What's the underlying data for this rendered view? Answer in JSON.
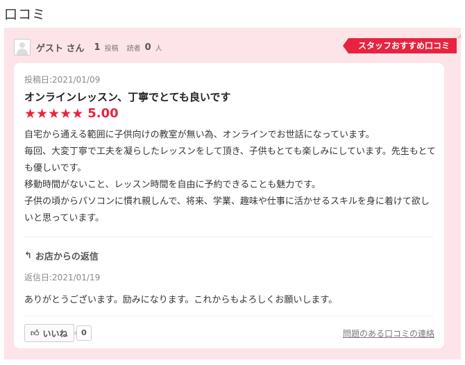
{
  "page": {
    "title": "口コミ"
  },
  "user": {
    "name": "ゲスト さん",
    "posts_count": "1",
    "posts_label": "投稿",
    "readers_label": "読者",
    "readers_count": "0",
    "readers_unit": "人"
  },
  "badge": {
    "label": "スタッフおすすめ口コミ"
  },
  "review": {
    "date": "投稿日:2021/01/09",
    "title": "オンラインレッスン、丁寧でとても良いです",
    "rating": "5.00",
    "rating_stars": 5,
    "body": [
      "自宅から通える範囲に子供向けの教室が無い為、オンラインでお世話になっています。",
      "毎回、大変丁寧で工夫を凝らしたレッスンをして頂き、子供もとても楽しみにしています。先生もとても優しいです。",
      "移動時間がないこと、レッスン時間を自由に予約できることも魅力です。",
      "子供の頃からパソコンに慣れ親しんで、将来、学業、趣味や仕事に活かせるスキルを身に着けて欲しいと思っています。"
    ]
  },
  "reply": {
    "heading": "お店からの返信",
    "date": "返信日:2021/01/19",
    "body": "ありがとうございます。励みになります。これからもよろしくお願いします。"
  },
  "actions": {
    "like_label": "いいね",
    "like_count": "0",
    "report_label": "問題のある口コミの連絡"
  },
  "colors": {
    "accent": "#e8233f",
    "card_bg": "#fde4e8"
  },
  "icons": {
    "reply": "reply-arrow-icon",
    "like": "thumbs-up-icon"
  }
}
